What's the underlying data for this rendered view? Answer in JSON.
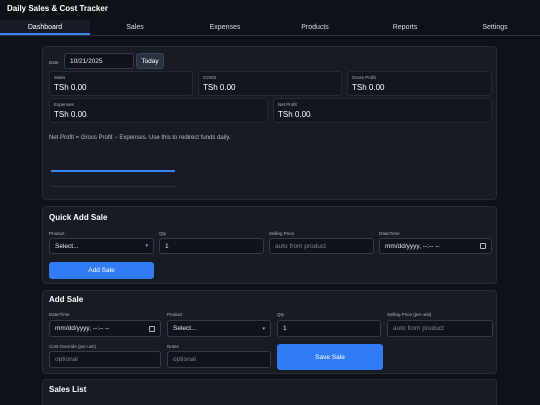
{
  "app": {
    "title": "Daily Sales & Cost Tracker"
  },
  "tabs": [
    "Dashboard",
    "Sales",
    "Expenses",
    "Products",
    "Reports",
    "Settings"
  ],
  "dashboard": {
    "date_label": "Date",
    "date_value": "10/21/2025",
    "today_button": "Today",
    "stats": {
      "sales": {
        "label": "Sales",
        "value": "TSh 0.00"
      },
      "cogs": {
        "label": "COGS",
        "value": "TSh 0.00"
      },
      "gross_profit": {
        "label": "Gross Profit",
        "value": "TSh 0.00"
      },
      "expenses": {
        "label": "Expenses",
        "value": "TSh 0.00"
      },
      "net_profit": {
        "label": "Net Profit",
        "value": "TSh 0.00"
      }
    },
    "hint": "Net Profit = Gross Profit − Expenses. Use this to redirect funds daily.",
    "accent_color": "#3b82f6"
  },
  "quick_add": {
    "title": "Quick Add Sale",
    "product_label": "Product",
    "product_value": "Select...",
    "qty_label": "Qty",
    "qty_value": "1",
    "price_label": "Selling Price",
    "price_placeholder": "auto from product",
    "datetime_label": "Date/Time",
    "datetime_placeholder": "mm/dd/yyyy, --:-- --",
    "button": "Add Sale"
  },
  "add_sale": {
    "title": "Add Sale",
    "datetime_label": "Date/Time",
    "datetime_placeholder": "mm/dd/yyyy, --:-- --",
    "product_label": "Product",
    "product_value": "Select...",
    "qty_label": "Qty",
    "qty_value": "1",
    "price_label": "Selling Price (per unit)",
    "price_placeholder": "auto from product",
    "cost_label": "Cost Override (per unit)",
    "cost_placeholder": "optional",
    "notes_label": "Notes",
    "notes_placeholder": "optional",
    "button": "Save Sale"
  },
  "sales_list": {
    "title": "Sales List"
  }
}
